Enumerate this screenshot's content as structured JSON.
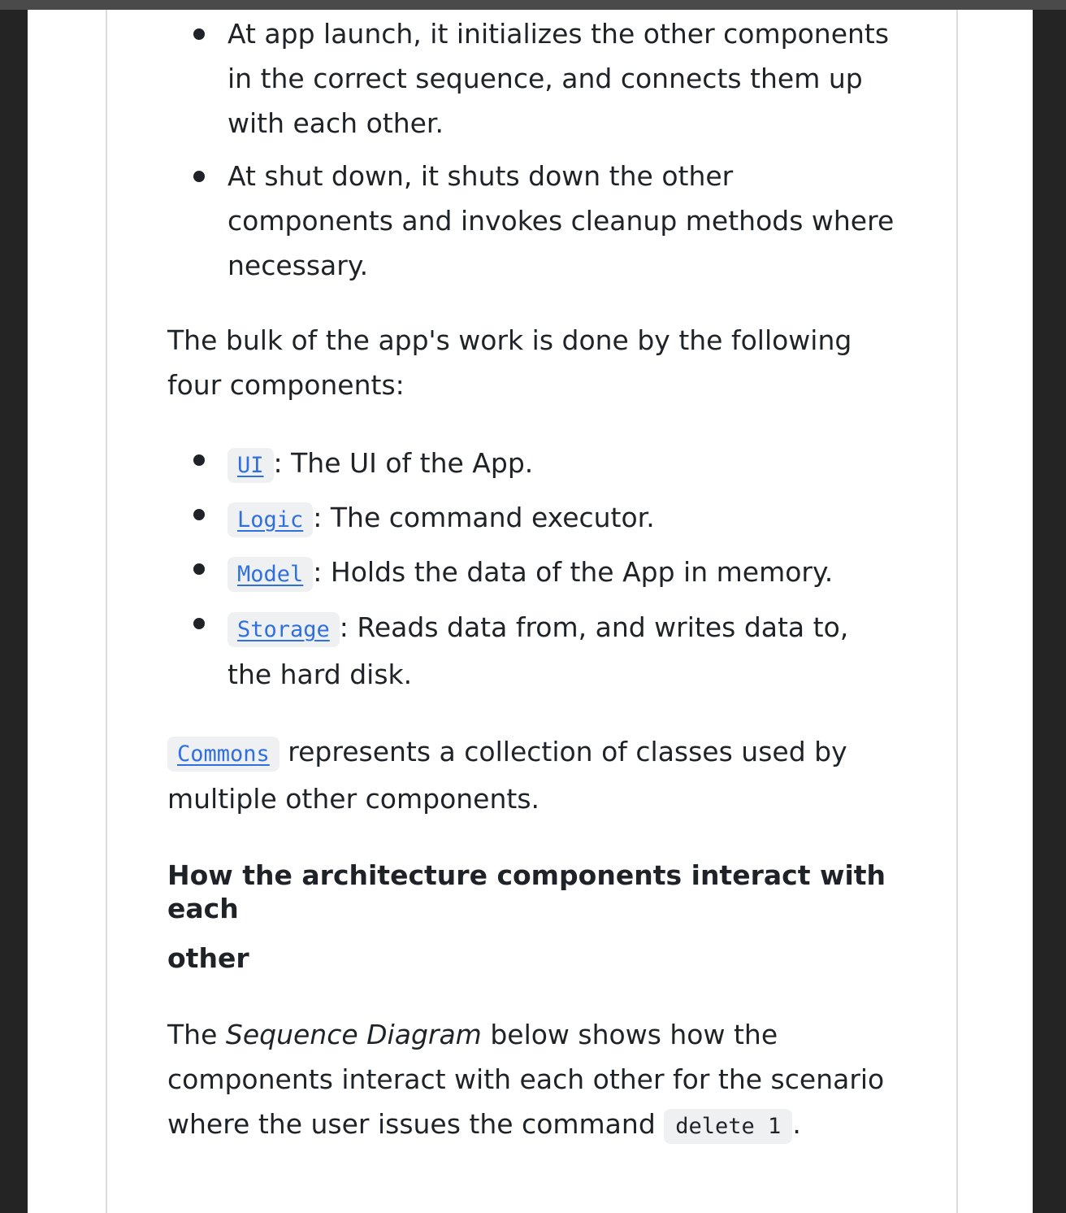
{
  "launch_items": [
    "At app launch, it initializes the other components in the correct sequence, and connects them up with each other.",
    "At shut down, it shuts down the other components and invokes cleanup methods where necessary."
  ],
  "bulk_paragraph": "The bulk of the app's work is done by the following four components:",
  "components": [
    {
      "code": "UI",
      "desc": ": The UI of the App."
    },
    {
      "code": "Logic",
      "desc": ": The command executor."
    },
    {
      "code": "Model",
      "desc": ": Holds the data of the App in memory."
    },
    {
      "code": "Storage",
      "desc": ": Reads data from, and writes data to, the hard disk."
    }
  ],
  "commons": {
    "code": "Commons",
    "text": " represents a collection of classes used by multiple other components."
  },
  "heading": {
    "line1": "How the architecture components interact with each",
    "line2": "other"
  },
  "sequence": {
    "prefix": "The ",
    "emphasis": "Sequence Diagram",
    "middle": " below shows how the components interact with each other for the scenario where the user issues the command ",
    "command": "delete 1",
    "suffix": "."
  }
}
